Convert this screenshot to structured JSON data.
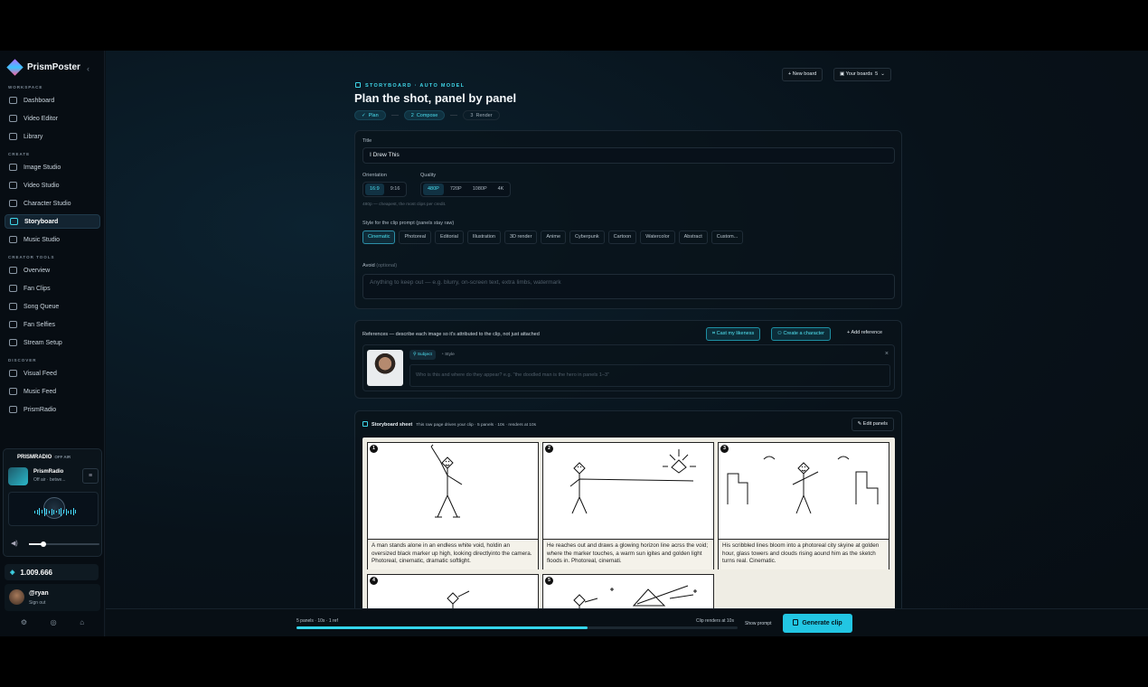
{
  "brand": {
    "name": "PrismPoster"
  },
  "sidebar": {
    "sections": [
      {
        "label": "WORKSPACE",
        "items": [
          "Dashboard",
          "Video Editor",
          "Library"
        ]
      },
      {
        "label": "CREATE",
        "items": [
          "Image Studio",
          "Video Studio",
          "Character Studio",
          "Storyboard",
          "Music Studio"
        ]
      },
      {
        "label": "CREATOR TOOLS",
        "items": [
          "Overview",
          "Fan Clips",
          "Song Queue",
          "Fan Selfies",
          "Stream Setup"
        ]
      },
      {
        "label": "DISCOVER",
        "items": [
          "Visual Feed",
          "Music Feed",
          "PrismRadio"
        ]
      }
    ],
    "active_item": "Storyboard",
    "radio": {
      "brand": "PRISMRADIO",
      "status": "OFF AIR",
      "name": "PrismRadio",
      "sub": "Off air · betwe...",
      "volume": 0.2
    },
    "credits": "1.009.666",
    "user": {
      "name": "@ryan",
      "action": "Sign out"
    }
  },
  "header": {
    "eyebrow": "STORYBOARD · AUTO MODEL",
    "title": "Plan the shot, panel by panel",
    "steps": [
      {
        "icon": "✓",
        "label": "Plan"
      },
      {
        "icon": "2",
        "label": "Compose"
      },
      {
        "icon": "3",
        "label": "Render"
      }
    ],
    "new_board": "New board",
    "your_boards": "Your boards",
    "boards_count": "5"
  },
  "form": {
    "title_label": "Title",
    "title_value": "I Drew This",
    "orientation_label": "Orientation",
    "orientations": [
      "16:9",
      "9:16"
    ],
    "quality_label": "Quality",
    "qualities": [
      "480P",
      "720P",
      "1080P",
      "4K"
    ],
    "quality_hint": "480p — cheapest, the most clips per credit.",
    "style_label": "Style for the clip prompt (panels stay raw)",
    "styles": [
      "Cinematic",
      "Photoreal",
      "Editorial",
      "Illustration",
      "3D render",
      "Anime",
      "Cyberpunk",
      "Cartoon",
      "Watercolor",
      "Abstract",
      "Custom..."
    ],
    "avoid_label": "Avoid",
    "avoid_optional": "(optional)",
    "avoid_placeholder": "Anything to keep out — e.g. blurry, on-screen text, extra limbs, watermark"
  },
  "references": {
    "label": "References — describe each image so it's attributed to the clip, not just attached",
    "cast_button": "Cast my likeness",
    "create_button": "Create a character",
    "add_button": "Add reference",
    "tab_subject": "Subject",
    "tab_style": "Style",
    "desc_placeholder": "Who is this and where do they appear? e.g. \"the doodled man is the hero in panels 1–3\""
  },
  "storyboard": {
    "title": "Storyboard sheet",
    "subtitle": "This raw page drives your clip · 5 panels · 10s · renders at 10s",
    "edit_button": "Edit panels",
    "panels": [
      {
        "num": "1",
        "caption": "A man stands alone in an endless white void, holdin an oversized black marker up high, looking directlyinto the camera. Photoreal, cinematic, dramatic softlight."
      },
      {
        "num": "2",
        "caption": "He reaches out and draws a glowing horizon line acrss the void; where the marker touches, a warm sun igites and golden light floods in. Photoreal, cinemati."
      },
      {
        "num": "3",
        "caption": "His scribbled lines bloom into a photoreal city skyine at golden hour, glass towers and clouds rising aound him as the sketch turns real. Cinematic."
      },
      {
        "num": "4",
        "caption": ""
      },
      {
        "num": "5",
        "caption": ""
      }
    ]
  },
  "footer": {
    "left_text": "5 panels · 10s · 1 ref",
    "right_text": "Clip renders at 10s",
    "progress": 0.66,
    "show_prompt": "Show prompt",
    "generate": "Generate clip"
  }
}
